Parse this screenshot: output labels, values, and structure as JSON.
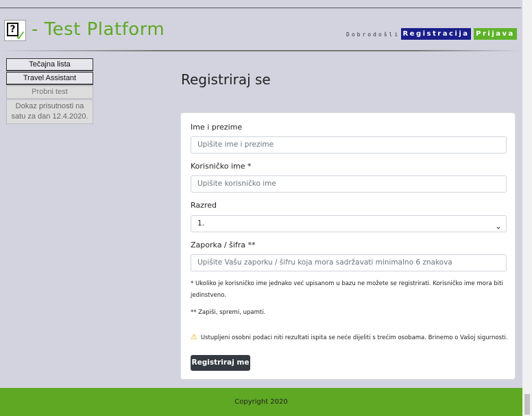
{
  "header": {
    "brand": "- Test Platform",
    "welcome": "Dobrodošli",
    "register_label": "Registracija",
    "login_label": "Prijava"
  },
  "sidebar": {
    "items": [
      {
        "label": "Tečajna lista"
      },
      {
        "label": "Travel Assistant"
      },
      {
        "label": "Probni test"
      },
      {
        "label": "Dokaz prisutnosti na satu za dan 12.4.2020."
      }
    ]
  },
  "main": {
    "title": "Registriraj se",
    "form": {
      "fullname_label": "Ime i prezime",
      "fullname_placeholder": "Upišite ime i prezime",
      "username_label": "Korisničko ime *",
      "username_placeholder": "Upišite korisničko ime",
      "grade_label": "Razred",
      "grade_value": "1.",
      "password_label": "Zaporka / šifra **",
      "password_placeholder": "Upišite Vašu zaporku / šifru koja mora sadržavati minimalno 6 znakova",
      "note1": "* Ukoliko je korisničko ime jednako već upisanom u bazu ne možete se registrirati. Korisničko ime mora biti jedinstveno.",
      "note2": "** Zapiši, spremi, upamti.",
      "warning": "Ustupljeni osobni podaci niti rezultati ispita se neće dijeliti s trećim osobama. Brinemo o Vašoj sigurnosti.",
      "submit_label": "Registriraj me"
    }
  },
  "footer": {
    "copyright": "Copyright 2020"
  },
  "colors": {
    "brand_green": "#5fa823",
    "register_blue": "#1a1f8a",
    "page_bg": "#d3d3e0"
  }
}
